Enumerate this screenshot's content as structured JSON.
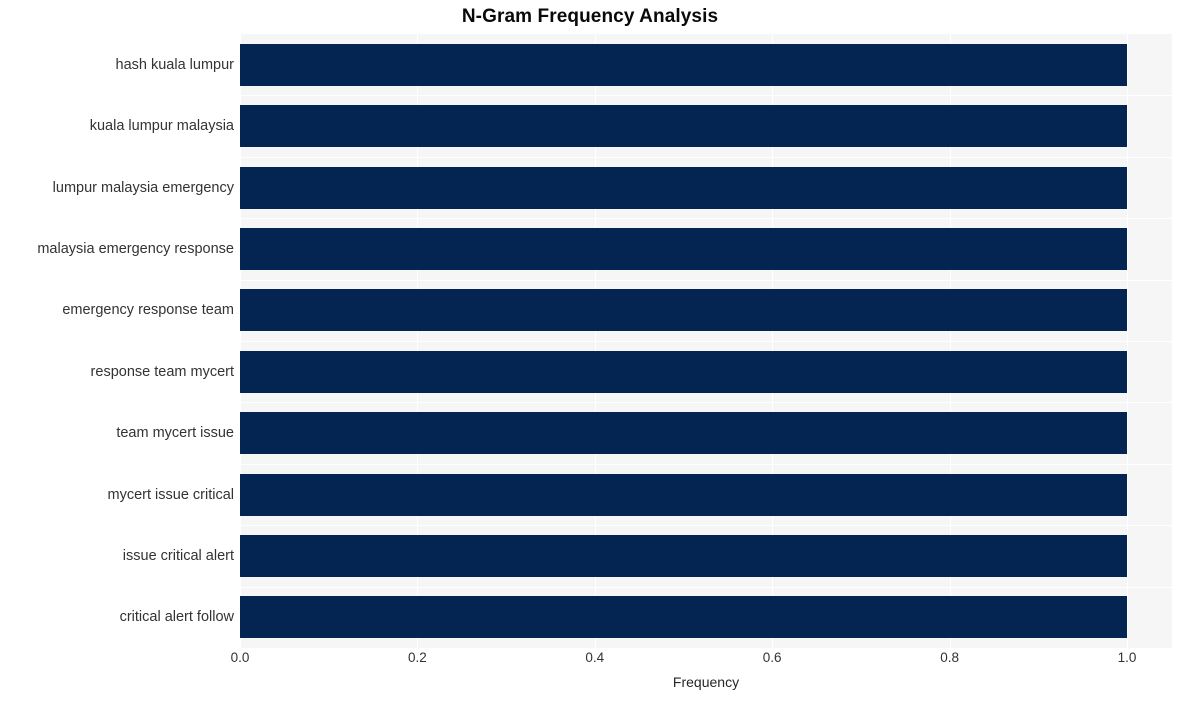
{
  "chart_data": {
    "type": "bar",
    "orientation": "horizontal",
    "title": "N-Gram Frequency Analysis",
    "xlabel": "Frequency",
    "ylabel": "",
    "categories": [
      "hash kuala lumpur",
      "kuala lumpur malaysia",
      "lumpur malaysia emergency",
      "malaysia emergency response",
      "emergency response team",
      "response team mycert",
      "team mycert issue",
      "mycert issue critical",
      "issue critical alert",
      "critical alert follow"
    ],
    "values": [
      1.0,
      1.0,
      1.0,
      1.0,
      1.0,
      1.0,
      1.0,
      1.0,
      1.0,
      1.0
    ],
    "xlim": [
      0.0,
      1.0
    ],
    "xticks": [
      "0.0",
      "0.2",
      "0.4",
      "0.6",
      "0.8",
      "1.0"
    ],
    "xtick_values": [
      0.0,
      0.2,
      0.4,
      0.6,
      0.8,
      1.0
    ],
    "grid": true,
    "legend": false,
    "colors": {
      "bar": "#042551",
      "plot_background": "#f7f6f7",
      "figure_background": "#ffffff",
      "gridline": "#ffffff",
      "title_text": "#0a0a0a",
      "tick_text": "#333333"
    }
  }
}
